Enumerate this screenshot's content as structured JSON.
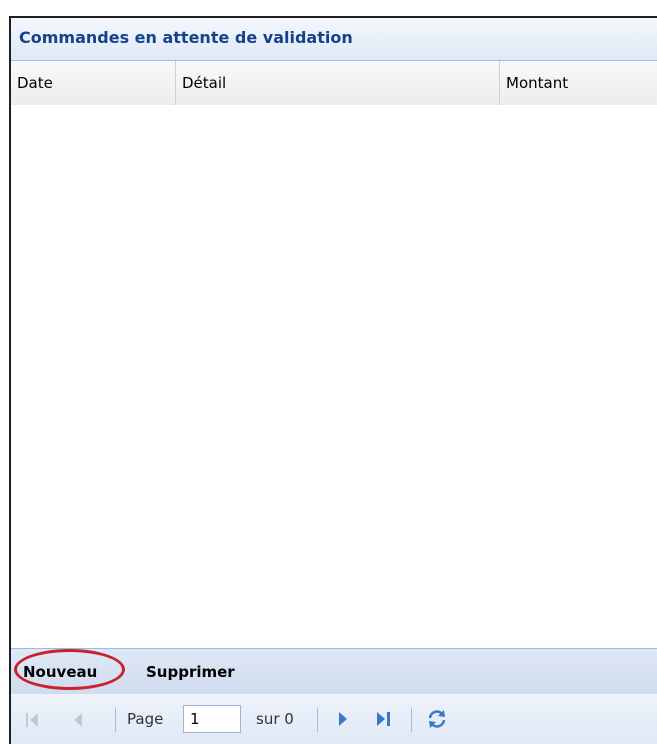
{
  "panel": {
    "title": "Commandes en attente de validation"
  },
  "grid": {
    "columns": [
      "Date",
      "Détail",
      "Montant"
    ],
    "rows": []
  },
  "toolbar": {
    "new_label": "Nouveau",
    "delete_label": "Supprimer"
  },
  "pager": {
    "page_label": "Page",
    "current_page": "1",
    "of_label": "sur 0",
    "icons": [
      "first-page-icon",
      "prev-page-icon",
      "next-page-icon",
      "last-page-icon",
      "refresh-icon"
    ]
  },
  "colors": {
    "title_text": "#15428b",
    "header_bg": "#dfe8f6",
    "border": "#99bbe8",
    "highlight_ring": "#c8232c",
    "nav_active": "#3a78c8",
    "nav_disabled": "#c3c9d1"
  }
}
